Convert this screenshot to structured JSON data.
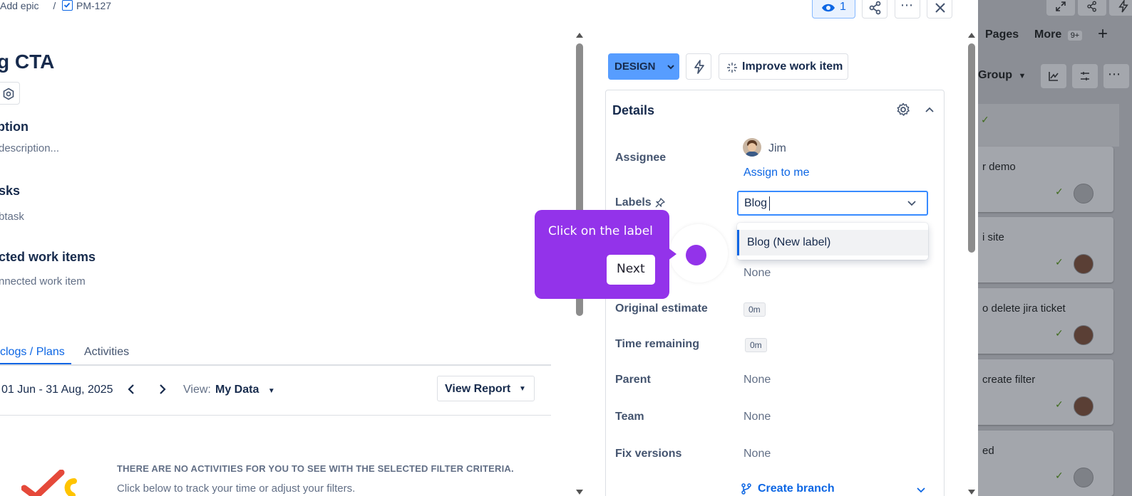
{
  "breadcrumb": {
    "epic_link": "Add epic",
    "separator": "/",
    "issue_key": "PM-127"
  },
  "issue": {
    "title_fragment": "g CTA"
  },
  "sections": {
    "description_heading": "ption",
    "description_placeholder": "description...",
    "subtasks_heading": "sks",
    "subtask_placeholder": "btask",
    "connected_heading": "cted work items",
    "connected_placeholder": "nnected work item"
  },
  "tabs": [
    {
      "label": "clogs / Plans",
      "active": true
    },
    {
      "label": "Activities",
      "active": false
    }
  ],
  "timesheet": {
    "date_range": "01 Jun - 31 Aug, 2025",
    "view_label": "View:",
    "view_value": "My Data",
    "report_button": "View Report",
    "empty_title": "THERE ARE NO ACTIVITIES FOR YOU TO SEE WITH THE SELECTED FILTER CRITERIA.",
    "empty_subtitle": "Click below to track your time or adjust your filters."
  },
  "toolbar": {
    "watch_count": "1"
  },
  "actions": {
    "status_button": "DESIGN",
    "improve_button": "Improve work item"
  },
  "details": {
    "heading": "Details",
    "fields": {
      "assignee_label": "Assignee",
      "assignee_value": "Jim",
      "assign_to_me": "Assign to me",
      "labels_label": "Labels",
      "labels_input_value": "Blog",
      "labels_option": "Blog (New label)",
      "hidden_field_value": "None",
      "original_estimate_label": "Original estimate",
      "original_estimate_value": "0m",
      "time_remaining_label": "Time remaining",
      "time_remaining_value": "0m",
      "parent_label": "Parent",
      "parent_value": "None",
      "team_label": "Team",
      "team_value": "None",
      "fix_versions_label": "Fix versions",
      "fix_versions_value": "None"
    },
    "create_branch": "Create branch"
  },
  "tooltip": {
    "text": "Click on the label",
    "next_button": "Next",
    "color": "#9333ea"
  },
  "backdrop": {
    "pages_tab": "Pages",
    "more_tab": "More",
    "more_badge": "9+",
    "group_button": "Group",
    "cards": [
      {
        "text": "r demo"
      },
      {
        "text": "i site"
      },
      {
        "text": "o delete jira ticket"
      },
      {
        "text": "create filter"
      },
      {
        "text": "ed"
      }
    ]
  },
  "colors": {
    "accent": "#0c66e4",
    "status_button": "#579dff",
    "tour_purple": "#9333ea"
  }
}
